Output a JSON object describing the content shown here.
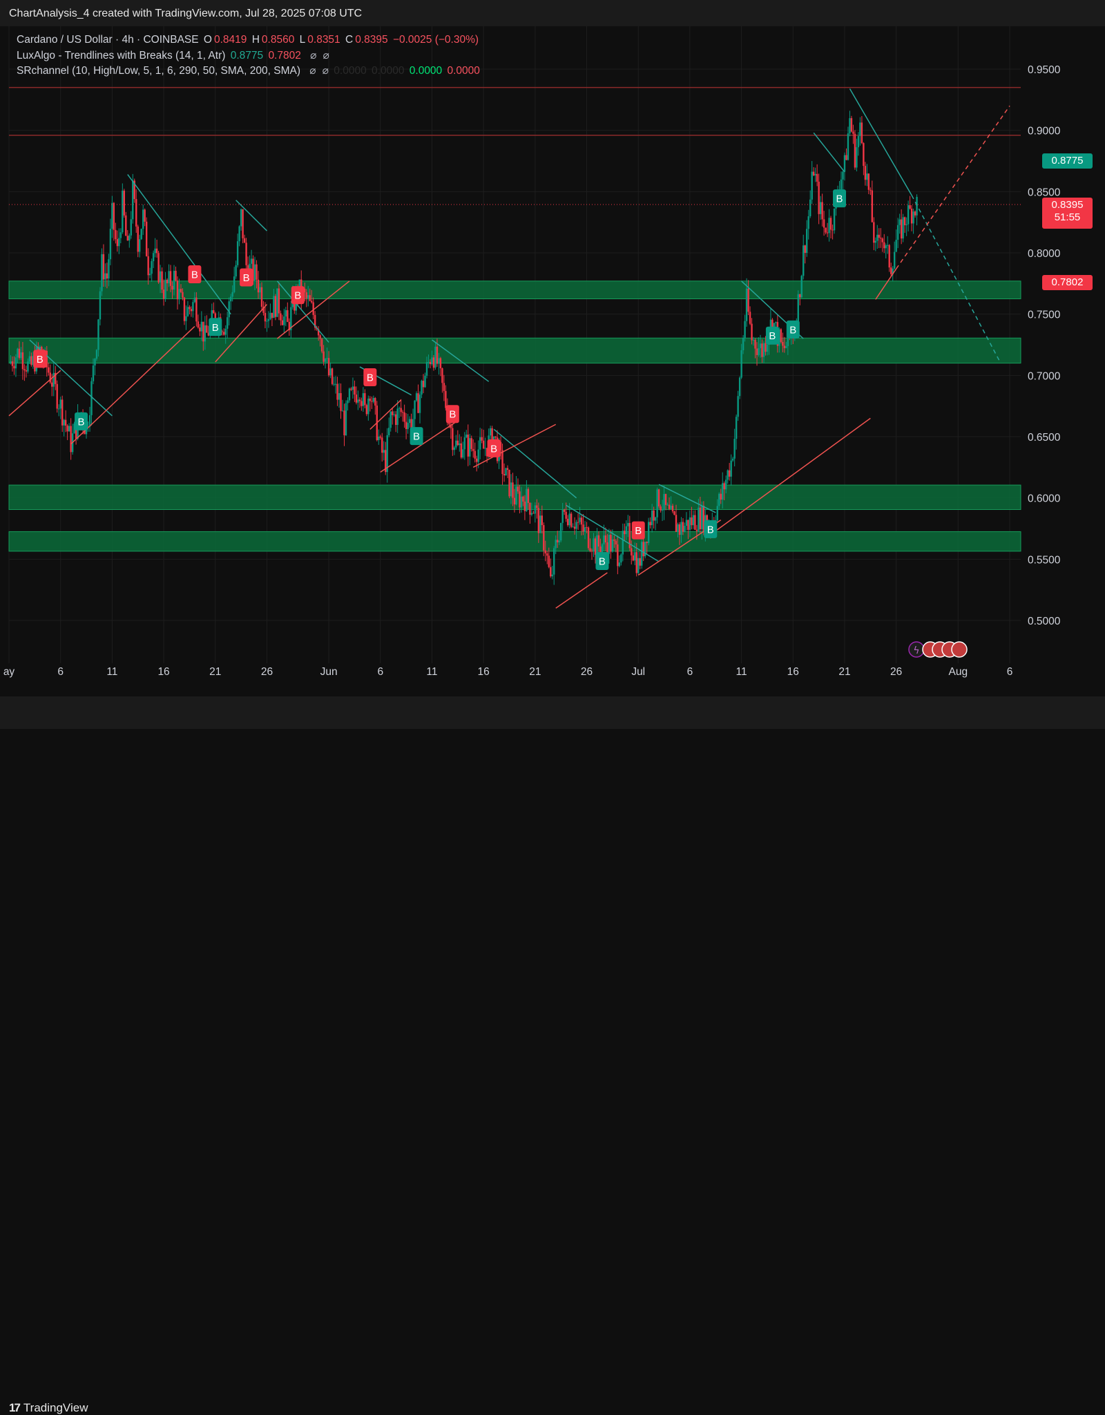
{
  "header": {
    "title": "ChartAnalysis_4 created with TradingView.com, Jul 28, 2025 07:08 UTC"
  },
  "legend": {
    "symbol": "Cardano / US Dollar · 4h · COINBASE",
    "o_label": "O",
    "o_value": "0.8419",
    "h_label": "H",
    "h_value": "0.8560",
    "l_label": "L",
    "l_value": "0.8351",
    "c_label": "C",
    "c_value": "0.8395",
    "change": "−0.0025 (−0.30%)",
    "indicator1": "LuxAlgo - Trendlines with Breaks (14, 1, Atr)",
    "indicator1_v1": "0.8775",
    "indicator1_v2": "0.7802",
    "indicator2": "SRchannel (10, High/Low, 5, 1, 6, 290, 50, SMA, 200, SMA)",
    "indicator2_v1": "0.0000",
    "indicator2_v2": "0.0000",
    "indicator2_v3": "0.0000",
    "indicator2_v4": "0.0000",
    "icon_glyph": "⌀"
  },
  "price_tags": {
    "upper_trend": "0.8775",
    "last_price": "0.8395",
    "countdown": "51:55",
    "lower_trend": "0.7802"
  },
  "footer": {
    "brand": "TradingView",
    "logo_mark": "17"
  },
  "colors": {
    "background": "#0f0f0f",
    "bull": "#089981",
    "bear": "#f23645",
    "trend_down": "#26a69a",
    "trend_up": "#f05350",
    "zone": "#0b6b3a",
    "resistance": "#8b2a2a",
    "buy_tag_teal": "#089981",
    "buy_tag_red": "#f23645"
  },
  "chart_data": {
    "type": "candlestick",
    "symbol": "Cardano / US Dollar",
    "timeframe": "4h",
    "exchange": "COINBASE",
    "ylim": [
      0.47,
      0.97
    ],
    "y_ticks": [
      0.95,
      0.9,
      0.85,
      0.8,
      0.75,
      0.7,
      0.65,
      0.6,
      0.55,
      0.5
    ],
    "x_ticks": [
      {
        "date": "2025-05-01",
        "label": "ay"
      },
      {
        "date": "2025-05-06",
        "label": "6"
      },
      {
        "date": "2025-05-11",
        "label": "11"
      },
      {
        "date": "2025-05-16",
        "label": "16"
      },
      {
        "date": "2025-05-21",
        "label": "21"
      },
      {
        "date": "2025-05-26",
        "label": "26"
      },
      {
        "date": "2025-06-01",
        "label": "Jun"
      },
      {
        "date": "2025-06-06",
        "label": "6"
      },
      {
        "date": "2025-06-11",
        "label": "11"
      },
      {
        "date": "2025-06-16",
        "label": "16"
      },
      {
        "date": "2025-06-21",
        "label": "21"
      },
      {
        "date": "2025-06-26",
        "label": "26"
      },
      {
        "date": "2025-07-01",
        "label": "Jul"
      },
      {
        "date": "2025-07-06",
        "label": "6"
      },
      {
        "date": "2025-07-11",
        "label": "11"
      },
      {
        "date": "2025-07-16",
        "label": "16"
      },
      {
        "date": "2025-07-21",
        "label": "21"
      },
      {
        "date": "2025-07-26",
        "label": "26"
      },
      {
        "date": "2025-08-01",
        "label": "Aug"
      },
      {
        "date": "2025-08-06",
        "label": "6"
      }
    ],
    "price_path": [
      [
        "2025-05-01",
        0.71
      ],
      [
        "2025-05-02",
        0.72
      ],
      [
        "2025-05-03",
        0.705
      ],
      [
        "2025-05-04",
        0.72
      ],
      [
        "2025-05-05",
        0.7
      ],
      [
        "2025-05-06",
        0.675
      ],
      [
        "2025-05-06T12:00",
        0.66
      ],
      [
        "2025-05-07",
        0.645
      ],
      [
        "2025-05-08",
        0.67
      ],
      [
        "2025-05-08T12:00",
        0.655
      ],
      [
        "2025-05-09",
        0.69
      ],
      [
        "2025-05-09T12:00",
        0.73
      ],
      [
        "2025-05-10",
        0.79
      ],
      [
        "2025-05-10T12:00",
        0.78
      ],
      [
        "2025-05-11",
        0.83
      ],
      [
        "2025-05-11T12:00",
        0.8
      ],
      [
        "2025-05-12",
        0.84
      ],
      [
        "2025-05-12T12:00",
        0.8
      ],
      [
        "2025-05-13",
        0.85
      ],
      [
        "2025-05-13T12:00",
        0.81
      ],
      [
        "2025-05-14",
        0.83
      ],
      [
        "2025-05-14T12:00",
        0.79
      ],
      [
        "2025-05-15",
        0.8
      ],
      [
        "2025-05-16",
        0.77
      ],
      [
        "2025-05-17",
        0.78
      ],
      [
        "2025-05-18",
        0.75
      ],
      [
        "2025-05-19",
        0.76
      ],
      [
        "2025-05-20",
        0.73
      ],
      [
        "2025-05-21",
        0.75
      ],
      [
        "2025-05-22",
        0.74
      ],
      [
        "2025-05-23",
        0.79
      ],
      [
        "2025-05-23T12:00",
        0.83
      ],
      [
        "2025-05-24",
        0.79
      ],
      [
        "2025-05-25",
        0.78
      ],
      [
        "2025-05-26",
        0.75
      ],
      [
        "2025-05-27",
        0.76
      ],
      [
        "2025-05-28",
        0.74
      ],
      [
        "2025-05-29",
        0.77
      ],
      [
        "2025-05-30",
        0.76
      ],
      [
        "2025-05-31",
        0.74
      ],
      [
        "2025-06-01",
        0.7
      ],
      [
        "2025-06-02",
        0.68
      ],
      [
        "2025-06-02T12:00",
        0.66
      ],
      [
        "2025-06-03",
        0.68
      ],
      [
        "2025-06-04",
        0.69
      ],
      [
        "2025-06-04T12:00",
        0.67
      ],
      [
        "2025-06-05",
        0.69
      ],
      [
        "2025-06-06",
        0.64
      ],
      [
        "2025-06-06T12:00",
        0.63
      ],
      [
        "2025-06-07",
        0.665
      ],
      [
        "2025-06-08",
        0.67
      ],
      [
        "2025-06-09",
        0.66
      ],
      [
        "2025-06-10",
        0.69
      ],
      [
        "2025-06-11",
        0.72
      ],
      [
        "2025-06-11T12:00",
        0.71
      ],
      [
        "2025-06-12",
        0.69
      ],
      [
        "2025-06-13",
        0.65
      ],
      [
        "2025-06-13T12:00",
        0.64
      ],
      [
        "2025-06-14",
        0.645
      ],
      [
        "2025-06-15",
        0.64
      ],
      [
        "2025-06-16",
        0.64
      ],
      [
        "2025-06-17",
        0.65
      ],
      [
        "2025-06-18",
        0.62
      ],
      [
        "2025-06-19",
        0.6
      ],
      [
        "2025-06-20",
        0.6
      ],
      [
        "2025-06-21",
        0.59
      ],
      [
        "2025-06-22",
        0.56
      ],
      [
        "2025-06-22T12:00",
        0.53
      ],
      [
        "2025-06-23",
        0.56
      ],
      [
        "2025-06-23T12:00",
        0.58
      ],
      [
        "2025-06-24",
        0.59
      ],
      [
        "2025-06-25",
        0.58
      ],
      [
        "2025-06-26",
        0.57
      ],
      [
        "2025-06-27",
        0.56
      ],
      [
        "2025-06-28",
        0.565
      ],
      [
        "2025-06-29",
        0.555
      ],
      [
        "2025-06-30",
        0.57
      ],
      [
        "2025-07-01",
        0.545
      ],
      [
        "2025-07-01T12:00",
        0.56
      ],
      [
        "2025-07-02",
        0.58
      ],
      [
        "2025-07-03",
        0.6
      ],
      [
        "2025-07-04",
        0.585
      ],
      [
        "2025-07-05",
        0.575
      ],
      [
        "2025-07-06",
        0.58
      ],
      [
        "2025-07-07",
        0.585
      ],
      [
        "2025-07-08",
        0.58
      ],
      [
        "2025-07-09",
        0.6
      ],
      [
        "2025-07-10",
        0.63
      ],
      [
        "2025-07-10T12:00",
        0.66
      ],
      [
        "2025-07-11",
        0.72
      ],
      [
        "2025-07-11T12:00",
        0.76
      ],
      [
        "2025-07-12",
        0.73
      ],
      [
        "2025-07-13",
        0.72
      ],
      [
        "2025-07-14",
        0.745
      ],
      [
        "2025-07-15",
        0.72
      ],
      [
        "2025-07-16",
        0.735
      ],
      [
        "2025-07-16T12:00",
        0.76
      ],
      [
        "2025-07-17",
        0.8
      ],
      [
        "2025-07-17T12:00",
        0.83
      ],
      [
        "2025-07-18",
        0.87
      ],
      [
        "2025-07-18T12:00",
        0.84
      ],
      [
        "2025-07-19",
        0.82
      ],
      [
        "2025-07-20",
        0.83
      ],
      [
        "2025-07-20T12:00",
        0.86
      ],
      [
        "2025-07-21",
        0.87
      ],
      [
        "2025-07-21T12:00",
        0.91
      ],
      [
        "2025-07-22",
        0.88
      ],
      [
        "2025-07-22T12:00",
        0.9
      ],
      [
        "2025-07-23",
        0.87
      ],
      [
        "2025-07-23T12:00",
        0.84
      ],
      [
        "2025-07-24",
        0.8
      ],
      [
        "2025-07-24T12:00",
        0.82
      ],
      [
        "2025-07-25",
        0.8
      ],
      [
        "2025-07-25T12:00",
        0.79
      ],
      [
        "2025-07-26",
        0.81
      ],
      [
        "2025-07-26T12:00",
        0.82
      ],
      [
        "2025-07-27",
        0.83
      ],
      [
        "2025-07-27T12:00",
        0.835
      ],
      [
        "2025-07-28",
        0.8395
      ]
    ],
    "sr_zones": [
      [
        0.7625,
        0.777
      ],
      [
        0.71,
        0.7305
      ],
      [
        0.5905,
        0.6105
      ],
      [
        0.5565,
        0.5725
      ]
    ],
    "resistance_lines": [
      0.935,
      0.896
    ],
    "last_price": 0.8395,
    "trendlines_down": [
      [
        [
          "2025-05-03",
          0.729
        ],
        [
          "2025-05-11",
          0.667
        ]
      ],
      [
        [
          "2025-05-12T12:00",
          0.864
        ],
        [
          "2025-05-22T12:00",
          0.75
        ]
      ],
      [
        [
          "2025-05-23",
          0.843
        ],
        [
          "2025-05-26",
          0.818
        ]
      ],
      [
        [
          "2025-05-27",
          0.777
        ],
        [
          "2025-06-01",
          0.727
        ]
      ],
      [
        [
          "2025-06-04",
          0.707
        ],
        [
          "2025-06-09",
          0.684
        ]
      ],
      [
        [
          "2025-06-11",
          0.729
        ],
        [
          "2025-06-16T12:00",
          0.695
        ]
      ],
      [
        [
          "2025-06-17",
          0.656
        ],
        [
          "2025-06-25",
          0.6
        ]
      ],
      [
        [
          "2025-06-24",
          0.594
        ],
        [
          "2025-07-03",
          0.548
        ]
      ],
      [
        [
          "2025-07-03",
          0.611
        ],
        [
          "2025-07-08T12:00",
          0.588
        ]
      ],
      [
        [
          "2025-07-11",
          0.777
        ],
        [
          "2025-07-17",
          0.73
        ]
      ],
      [
        [
          "2025-07-18",
          0.898
        ],
        [
          "2025-07-21",
          0.866
        ]
      ],
      [
        [
          "2025-07-21T12:00",
          0.934
        ],
        [
          "2025-07-27T12:00",
          0.847
        ]
      ]
    ],
    "trendlines_down_projected": [
      [
        [
          "2025-07-27T12:00",
          0.847
        ],
        [
          "2025-08-05",
          0.712
        ]
      ]
    ],
    "trendlines_up": [
      [
        [
          "2025-05-01",
          0.667
        ],
        [
          "2025-05-06",
          0.704
        ]
      ],
      [
        [
          "2025-05-07",
          0.644
        ],
        [
          "2025-05-19",
          0.74
        ]
      ],
      [
        [
          "2025-05-21",
          0.711
        ],
        [
          "2025-05-26",
          0.758
        ]
      ],
      [
        [
          "2025-05-27",
          0.73
        ],
        [
          "2025-06-03",
          0.777
        ]
      ],
      [
        [
          "2025-06-05",
          0.656
        ],
        [
          "2025-06-08",
          0.68
        ]
      ],
      [
        [
          "2025-06-06",
          0.621
        ],
        [
          "2025-06-13T12:00",
          0.663
        ]
      ],
      [
        [
          "2025-06-15",
          0.625
        ],
        [
          "2025-06-23",
          0.66
        ]
      ],
      [
        [
          "2025-06-23",
          0.51
        ],
        [
          "2025-06-28",
          0.539
        ]
      ],
      [
        [
          "2025-07-01",
          0.537
        ],
        [
          "2025-07-09",
          0.582
        ]
      ],
      [
        [
          "2025-07-08",
          0.57
        ],
        [
          "2025-07-23T12:00",
          0.665
        ]
      ],
      [
        [
          "2025-07-24",
          0.762
        ],
        [
          "2025-07-26",
          0.787
        ]
      ]
    ],
    "trendlines_up_projected": [
      [
        [
          "2025-07-26",
          0.787
        ],
        [
          "2025-08-06",
          0.92
        ]
      ]
    ],
    "break_labels": [
      {
        "date": "2025-05-04",
        "price": 0.7135,
        "label": "B",
        "kind": "red"
      },
      {
        "date": "2025-05-08",
        "price": 0.6625,
        "label": "B",
        "kind": "teal"
      },
      {
        "date": "2025-05-19",
        "price": 0.7825,
        "label": "B",
        "kind": "red"
      },
      {
        "date": "2025-05-21",
        "price": 0.7395,
        "label": "B",
        "kind": "teal"
      },
      {
        "date": "2025-05-24",
        "price": 0.78,
        "label": "B",
        "kind": "red"
      },
      {
        "date": "2025-05-29",
        "price": 0.7655,
        "label": "B",
        "kind": "red"
      },
      {
        "date": "2025-06-05",
        "price": 0.6985,
        "label": "B",
        "kind": "red"
      },
      {
        "date": "2025-06-09T12:00",
        "price": 0.6505,
        "label": "B",
        "kind": "teal"
      },
      {
        "date": "2025-06-13",
        "price": 0.6685,
        "label": "B",
        "kind": "red"
      },
      {
        "date": "2025-06-17",
        "price": 0.6405,
        "label": "B",
        "kind": "red"
      },
      {
        "date": "2025-06-27T12:00",
        "price": 0.5485,
        "label": "B",
        "kind": "teal"
      },
      {
        "date": "2025-07-01",
        "price": 0.5735,
        "label": "B",
        "kind": "red"
      },
      {
        "date": "2025-07-08",
        "price": 0.5745,
        "label": "B",
        "kind": "teal"
      },
      {
        "date": "2025-07-14",
        "price": 0.7325,
        "label": "B",
        "kind": "teal"
      },
      {
        "date": "2025-07-16",
        "price": 0.7375,
        "label": "B",
        "kind": "teal"
      },
      {
        "date": "2025-07-20T12:00",
        "price": 0.8445,
        "label": "B",
        "kind": "teal"
      }
    ]
  }
}
